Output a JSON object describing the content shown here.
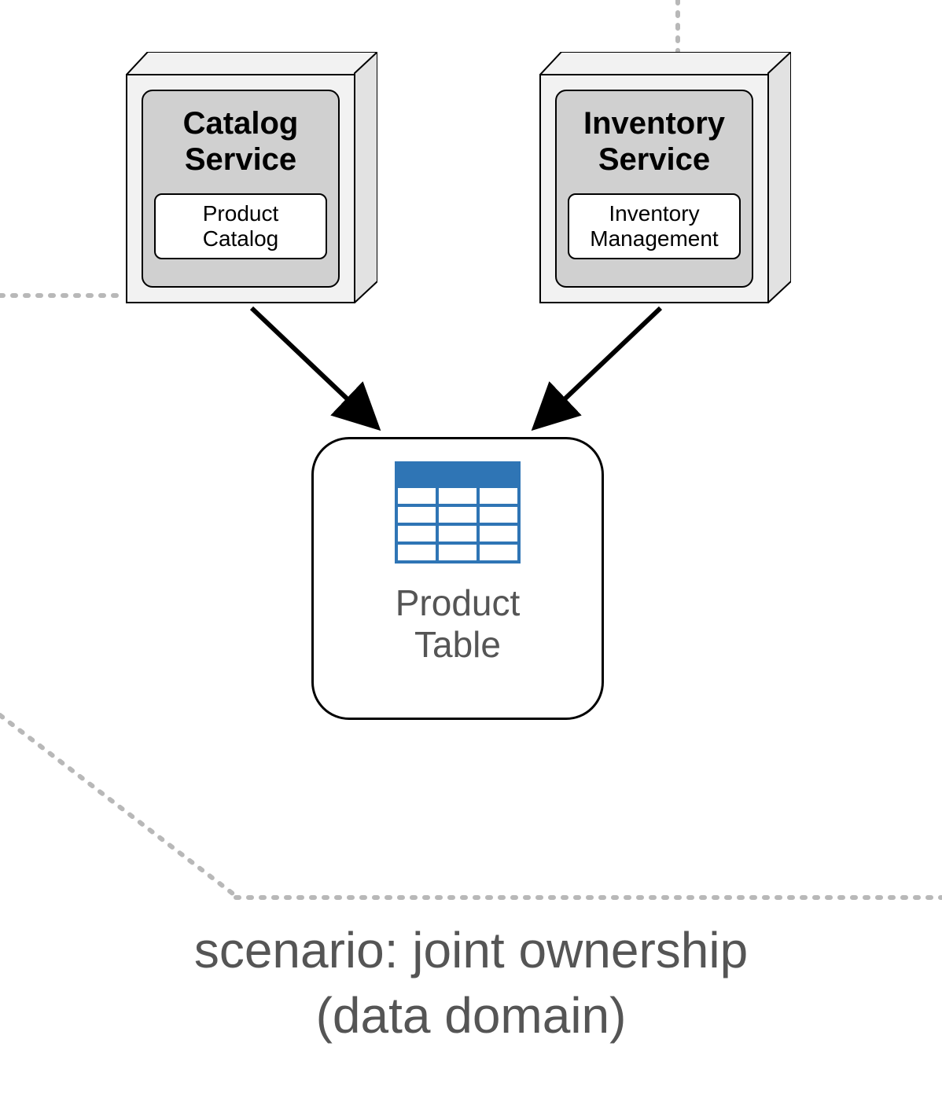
{
  "services": [
    {
      "title_l1": "Catalog",
      "title_l2": "Service",
      "module_l1": "Product",
      "module_l2": "Catalog"
    },
    {
      "title_l1": "Inventory",
      "title_l2": "Service",
      "module_l1": "Inventory",
      "module_l2": "Management"
    }
  ],
  "database": {
    "label_l1": "Product",
    "label_l2": "Table"
  },
  "caption": {
    "line1": "scenario: joint ownership",
    "line2": "(data domain)"
  },
  "colors": {
    "table_header": "#2f75b5",
    "table_border": "#2f75b5",
    "table_cell": "#ffffff",
    "box_face": "#f2f2f2",
    "box_inner": "#d0d0d0",
    "caption_text": "#555555",
    "dotted": "#b8b8b8"
  }
}
